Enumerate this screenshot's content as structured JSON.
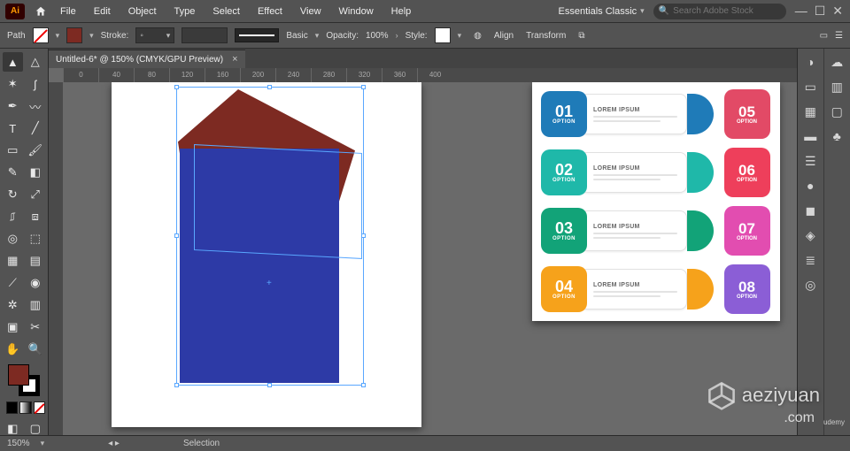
{
  "app_badge": "Ai",
  "menu": [
    "File",
    "Edit",
    "Object",
    "Type",
    "Select",
    "Effect",
    "View",
    "Window",
    "Help"
  ],
  "header": {
    "workspace": "Essentials Classic",
    "search_placeholder": "Search Adobe Stock"
  },
  "control": {
    "path_label": "Path",
    "stroke_label": "Stroke:",
    "profile": "Basic",
    "opacity_label": "Opacity:",
    "opacity_value": "100%",
    "style_label": "Style:",
    "align_label": "Align",
    "transform_label": "Transform"
  },
  "tab": {
    "title": "Untitled-6* @ 150% (CMYK/GPU Preview)"
  },
  "ruler_ticks": [
    "0",
    "40",
    "80",
    "120",
    "160",
    "200",
    "240",
    "280",
    "320",
    "360",
    "400"
  ],
  "option_label": "OPTION",
  "lorem": "LOREM IPSUM",
  "info_items": [
    {
      "num": "01",
      "color": "#1f7bb8",
      "tail": "#1f7bb8"
    },
    {
      "num": "02",
      "color": "#1fb8a9",
      "tail": "#1fb8a9"
    },
    {
      "num": "03",
      "color": "#12a378",
      "tail": "#12a378"
    },
    {
      "num": "04",
      "color": "#f6a21b",
      "tail": "#f6a21b"
    }
  ],
  "info_right": [
    {
      "num": "05",
      "color": "#e24a66"
    },
    {
      "num": "06",
      "color": "#ee3f5b"
    },
    {
      "num": "07",
      "color": "#e24db0"
    },
    {
      "num": "08",
      "color": "#8b5ed6"
    }
  ],
  "status": {
    "zoom": "150%",
    "tool": "Selection"
  },
  "watermark": {
    "brand": "aeziyuan",
    "suffix": ".com",
    "tag": "udemy"
  }
}
